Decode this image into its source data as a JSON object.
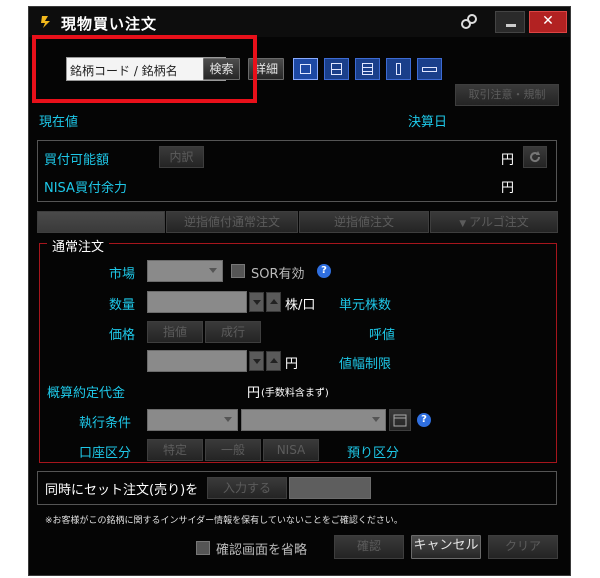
{
  "window": {
    "title": "現物買い注文"
  },
  "search": {
    "selected": "銘柄コード / 銘柄名",
    "search_label": "検索",
    "detail_label": "詳細"
  },
  "layout_buttons": [
    "layout-1",
    "layout-2h",
    "layout-3h",
    "layout-2v",
    "layout-wide"
  ],
  "top_right": {
    "label": "取引注意・規制"
  },
  "info": {
    "current_price": "現在値",
    "settlement": "決算日"
  },
  "buying": {
    "label": "買付可能額",
    "breakdown": "内訳",
    "yen": "円",
    "nisa_label": "NISA買付余力",
    "nisa_yen": "円"
  },
  "tabs": [
    "通常注文",
    "逆指値付通常注文",
    "逆指値注文",
    "アルゴ注文"
  ],
  "order": {
    "section": "通常注文",
    "market_label": "市場",
    "sor_label": "SOR有効",
    "qty_label": "数量",
    "qty_unit": "株/口",
    "unit_shares": "単元株数",
    "price_label": "価格",
    "limit_btn": "指値",
    "market_btn": "成行",
    "tick": "呼値",
    "price_unit": "円",
    "price_range": "値幅制限",
    "estimate_label": "概算約定代金",
    "estimate_unit": "円",
    "estimate_note": "(手数料含まず)",
    "exec_label": "執行条件",
    "account_label": "口座区分",
    "acct_specific": "特定",
    "acct_general": "一般",
    "acct_nisa": "NISA",
    "custody": "預り区分"
  },
  "set_order": {
    "label": "同時にセット注文(売り)を",
    "btn": "入力する"
  },
  "notice": "※お客様がこの銘柄に関するインサイダー情報を保有していないことをご確認ください。",
  "footer": {
    "skip_confirm": "確認画面を省略",
    "confirm": "確認",
    "cancel": "キャンセル",
    "clear": "クリア"
  },
  "colors": {
    "accent": "#1ec8e8",
    "highlight": "#e8101a",
    "layout_blue": "#1d48a3"
  }
}
